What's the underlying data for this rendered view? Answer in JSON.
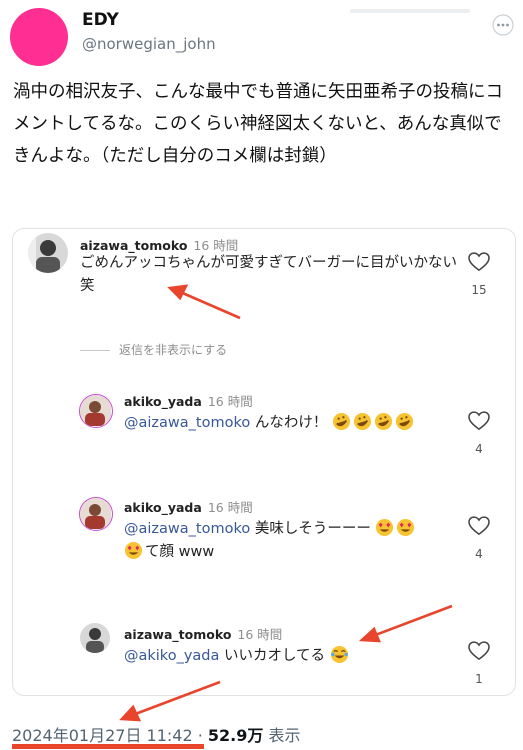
{
  "tweet": {
    "display_name": "EDY",
    "handle": "@norwegian_john",
    "text": "渦中の相沢友子、こんな最中でも普通に矢田亜希子の投稿にコメントしてるな。このくらい神経図太くないと、あんな真似できんよな。（ただし自分のコメ欄は封鎖）",
    "avatar_color": "#ff2e93"
  },
  "screenshot": {
    "comments": [
      {
        "user": "aizawa_tomoko",
        "time": "16 時間",
        "text": "ごめんアッコちゃんが可愛すぎてバーガーに目がいかない笑",
        "likes": "15"
      },
      {
        "user": "akiko_yada",
        "time": "16 時間",
        "mention": "@aizawa_tomoko",
        "text": " んなわけ！",
        "emoji": [
          "rofl-emoji",
          "rofl-emoji",
          "rofl-emoji",
          "rofl-emoji"
        ],
        "likes": "4"
      },
      {
        "user": "akiko_yada",
        "time": "16 時間",
        "mention": "@aizawa_tomoko",
        "text": " 美味しそうーーー",
        "text2": "て顔 www",
        "emoji": [
          "heart-eyes-emoji",
          "heart-eyes-emoji",
          "heart-eyes-emoji"
        ],
        "likes": "4"
      },
      {
        "user": "aizawa_tomoko",
        "time": "16 時間",
        "mention": "@akiko_yada",
        "text": " いいカオしてる",
        "emoji": [
          "laughing-tears-emoji"
        ],
        "likes": "1"
      }
    ],
    "hide_replies": "返信を非表示にする"
  },
  "meta": {
    "datetime": "2024年01月27日 11:42",
    "separator": " · ",
    "views_value": "52.9万",
    "views_label": " 表示"
  },
  "colors": {
    "annotation_red": "#e8452c",
    "mention_blue": "#385898"
  }
}
